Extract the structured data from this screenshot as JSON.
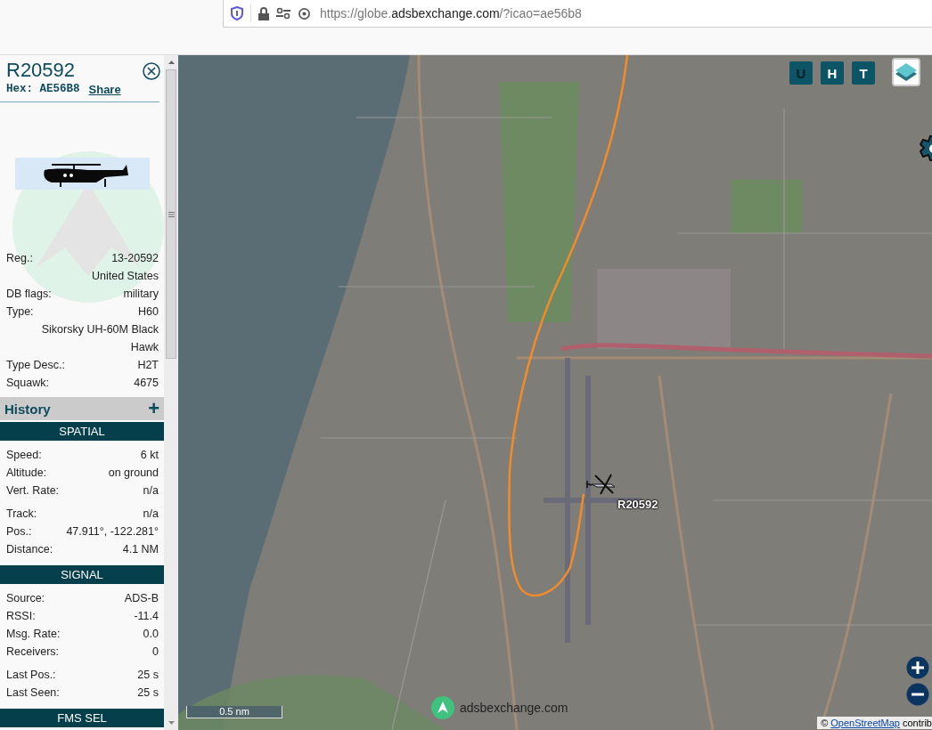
{
  "browser": {
    "url_prefix": "https://globe.",
    "url_domain": "adsbexchange.com",
    "url_suffix": "/?icao=ae56b8"
  },
  "sidebar": {
    "callsign": "R20592",
    "hex_label": "Hex:",
    "hex": "AE56B8",
    "share": "Share",
    "details": [
      {
        "label": "Reg.:",
        "value": "13-20592"
      },
      {
        "value": "United States"
      },
      {
        "label": "DB flags:",
        "value": "military"
      },
      {
        "label": "Type:",
        "value": "H60"
      },
      {
        "value": "Sikorsky UH-60M Black Hawk"
      },
      {
        "label": "Type Desc.:",
        "value": "H2T"
      },
      {
        "label": "Squawk:",
        "value": "4675"
      }
    ],
    "history": {
      "title": "History",
      "toggle": "+"
    },
    "sections": [
      {
        "title": "SPATIAL",
        "groups": [
          [
            {
              "label": "Speed:",
              "value": "6 kt"
            },
            {
              "label": "Altitude:",
              "value": "on ground"
            },
            {
              "label": "Vert. Rate:",
              "value": "n/a"
            }
          ],
          [
            {
              "label": "Track:",
              "value": "n/a"
            },
            {
              "label": "Pos.:",
              "value": "47.911°, -122.281°"
            },
            {
              "label": "Distance:",
              "value": "4.1 NM"
            }
          ]
        ]
      },
      {
        "title": "SIGNAL",
        "groups": [
          [
            {
              "label": "Source:",
              "value": "ADS-B"
            },
            {
              "label": "RSSI:",
              "value": "-11.4"
            },
            {
              "label": "Msg. Rate:",
              "value": "0.0"
            },
            {
              "label": "Receivers:",
              "value": "0"
            }
          ],
          [
            {
              "label": "Last Pos.:",
              "value": "25 s"
            },
            {
              "label": "Last Seen:",
              "value": "25 s"
            }
          ]
        ]
      },
      {
        "title": "FMS SEL"
      }
    ]
  },
  "map": {
    "toggles": [
      {
        "label": "U",
        "on": false
      },
      {
        "label": "H",
        "on": true
      },
      {
        "label": "T",
        "on": true
      }
    ],
    "aircraft_label": "R20592",
    "scale": "0.5 nm",
    "logo_text": "adsbexchange.com",
    "attribution": {
      "symbol": "©",
      "link": "OpenStreetMap",
      "rest": "contrib"
    }
  }
}
